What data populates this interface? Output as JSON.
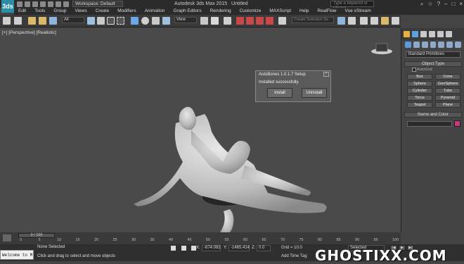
{
  "app": {
    "logo": "3ds",
    "title": "Autodesk 3ds Max 2015",
    "document": "Untitled"
  },
  "workspace": {
    "label": "Workspace: Default"
  },
  "search": {
    "placeholder": "Type a keyword or phrase"
  },
  "menu": [
    "Edit",
    "Tools",
    "Group",
    "Views",
    "Create",
    "Modifiers",
    "Animation",
    "Graph Editors",
    "Rendering",
    "Customize",
    "MAXScript",
    "Help",
    "RealFlow",
    "Vue xStream"
  ],
  "toolbar": {
    "filter": "All",
    "view": "View",
    "selection_set": "Create Selection Se"
  },
  "viewport": {
    "label": "[+] [Perspective] [Realistic]"
  },
  "dialog": {
    "title": "AutoBones 1.0.1.7 Setup",
    "message": "Installed successfully.",
    "install_label": "Install",
    "uninstall_label": "Uninstall",
    "close_glyph": "×"
  },
  "command_panel": {
    "primitive_type": "Standard Primitives",
    "object_type_header": "Object Type",
    "autogrid": "AutoGrid",
    "objects": [
      "Box",
      "Cone",
      "Sphere",
      "GeoSphere",
      "Cylinder",
      "Tube",
      "Torus",
      "Pyramid",
      "Teapot",
      "Plane"
    ],
    "name_color_header": "Name and Color",
    "object_color": "#c8387c"
  },
  "timeline": {
    "slider": "0 / 100",
    "ticks": [
      "0",
      "5",
      "10",
      "15",
      "20",
      "25",
      "30",
      "35",
      "40",
      "45",
      "50",
      "55",
      "60",
      "65",
      "70",
      "75",
      "80",
      "85",
      "90",
      "95",
      "100"
    ]
  },
  "status": {
    "welcome": "Welcome to M",
    "selection": "None Selected",
    "prompt": "Click and drag to select and move objects",
    "x_label": "X:",
    "x_value": "-674.082",
    "y_label": "Y:",
    "y_value": "-1465.414",
    "z_label": "Z:",
    "z_value": "0.0",
    "grid": "Grid = 10.0",
    "add_time_tag": "Add Time Tag",
    "selected_dd": "Selected"
  },
  "watermark": "GHOSTIXX.COM"
}
